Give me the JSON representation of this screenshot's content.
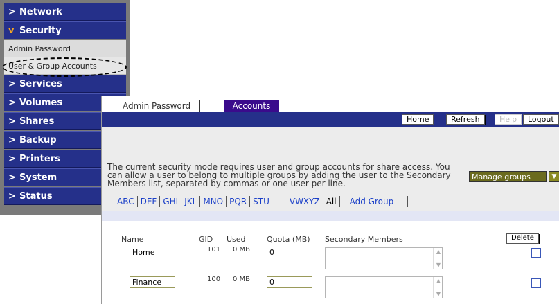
{
  "sidebar": {
    "items": [
      {
        "label": "Network",
        "open": false
      },
      {
        "label": "Security",
        "open": true
      },
      {
        "label": "Services",
        "open": false
      },
      {
        "label": "Volumes",
        "open": false
      },
      {
        "label": "Shares",
        "open": false
      },
      {
        "label": "Backup",
        "open": false
      },
      {
        "label": "Printers",
        "open": false
      },
      {
        "label": "System",
        "open": false
      },
      {
        "label": "Status",
        "open": false
      }
    ],
    "security_sub": [
      "Admin Password",
      "User & Group Accounts"
    ],
    "chevron": ">",
    "chevron_open": "v"
  },
  "tabs": [
    "Admin Password",
    "Accounts"
  ],
  "toolbar": {
    "home": "Home",
    "refresh": "Refresh",
    "help": "Help",
    "logout": "Logout"
  },
  "description": "The current security mode requires user and group accounts for share access. You can allow a user to belong to multiple groups by adding the user to the Secondary Members list, separated by commas or one user per line.",
  "manage_select": "Manage groups",
  "letter_filters": [
    "ABC",
    "DEF",
    "GHI",
    "JKL",
    "MNO",
    "PQR",
    "STU",
    "VWXYZ",
    "All"
  ],
  "add_group": "Add Group",
  "table": {
    "headers": [
      "Name",
      "GID",
      "Used",
      "Quota (MB)",
      "Secondary Members"
    ],
    "delete_label": "Delete",
    "rows": [
      {
        "name": "Home",
        "gid": "101",
        "used": "0 MB",
        "quota": "0"
      },
      {
        "name": "Finance",
        "gid": "100",
        "used": "0 MB",
        "quota": "0"
      }
    ]
  },
  "colors": {
    "nav": "#25308a",
    "active_tab": "#3a0b8c",
    "accent_chevron": "#f5a623"
  }
}
